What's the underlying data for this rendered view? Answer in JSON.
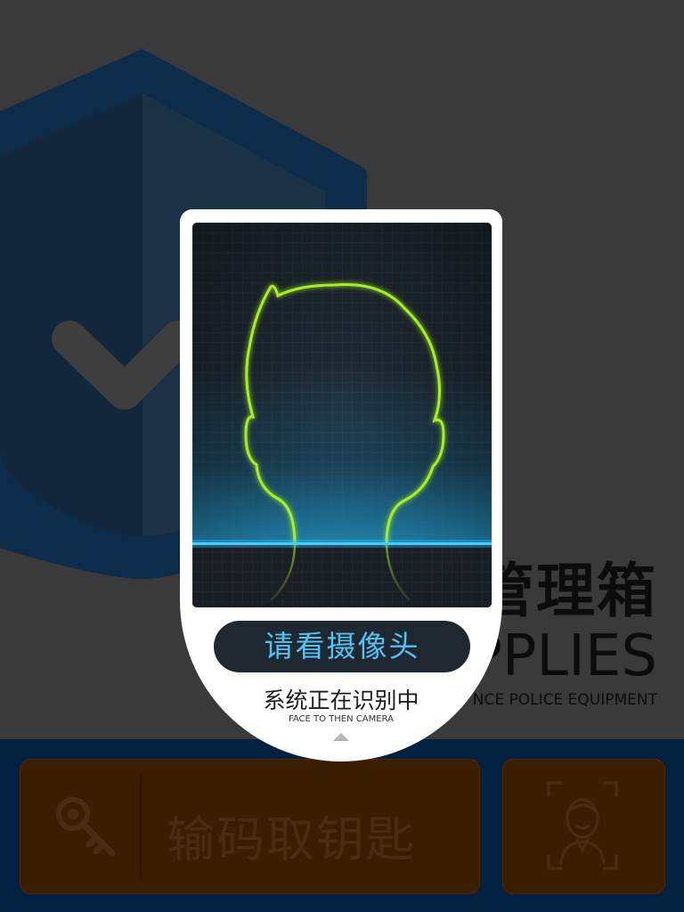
{
  "background": {
    "brand_cn": "管理箱",
    "brand_en": "PPLIES",
    "brand_sub": "NCE POLICE EQUIPMENT"
  },
  "scan_card": {
    "prompt": "请看摄像头",
    "status_cn": "系统正在识别中",
    "status_en": "FACE TO THEN CAMERA"
  },
  "actions": {
    "key_button_label": "输码取钥匙"
  },
  "icons": {
    "shield": "shield-check-icon",
    "key": "key-icon",
    "face": "face-scan-icon",
    "head_outline": "head-outline-icon",
    "caret": "caret-up-icon"
  },
  "colors": {
    "background": "#3a3a3a",
    "shield": "#0d2c4a",
    "bottom_bar": "#022140",
    "button": "#3b1e02",
    "scan_outline": "#a6f021",
    "scan_line": "#1fa8e6",
    "prompt_text": "#52c3f3"
  }
}
